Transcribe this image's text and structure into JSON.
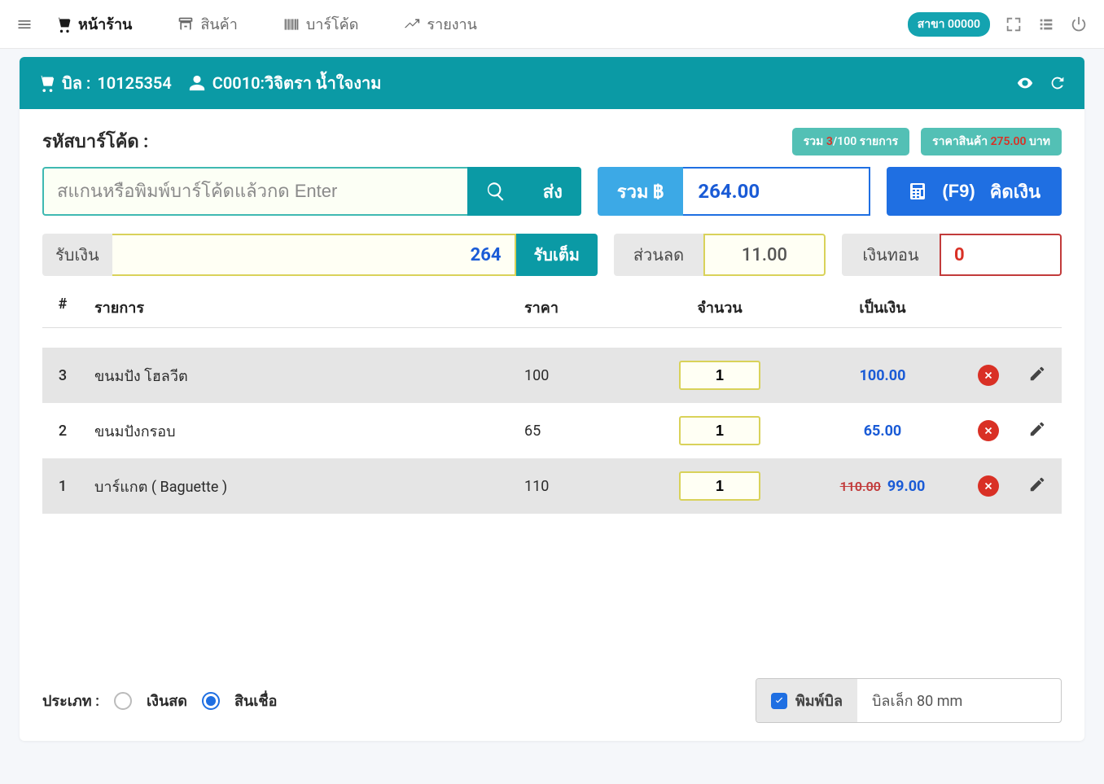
{
  "nav": {
    "items": [
      {
        "label": "หน้าร้าน",
        "active": true
      },
      {
        "label": "สินค้า",
        "active": false
      },
      {
        "label": "บาร์โค้ด",
        "active": false
      },
      {
        "label": "รายงาน",
        "active": false
      }
    ],
    "branch_badge": "สาขา 00000"
  },
  "bill": {
    "bill_prefix": "บิล :",
    "bill_no": "10125354",
    "customer": "C0010:วิจิตรา น้ำใจงาม"
  },
  "barcode": {
    "label": "รหัสบาร์โค้ด :",
    "placeholder": "สแกนหรือพิมพ์บาร์โค้ดแล้วกด Enter",
    "send_label": "ส่ง"
  },
  "summary": {
    "items_badge_prefix": "รวม ",
    "items_badge_count": "3",
    "items_badge_suffix": "/100 รายการ",
    "price_badge_prefix": "ราคาสินค้า ",
    "price_badge_amount": "275.00",
    "price_badge_suffix": " บาท",
    "total_prefix": "รวม ฿",
    "total_value": "264.00",
    "checkout_f9": "(F9)",
    "checkout_label": "คิดเงิน"
  },
  "receive": {
    "label": "รับเงิน",
    "value": "264",
    "full_label": "รับเต็ม"
  },
  "discount": {
    "label": "ส่วนลด",
    "value": "11.00"
  },
  "change": {
    "label": "เงินทอน",
    "value": "0"
  },
  "table": {
    "head_num": "#",
    "head_item": "รายการ",
    "head_price": "ราคา",
    "head_qty": "จำนวน",
    "head_amount": "เป็นเงิน",
    "rows": [
      {
        "num": "3",
        "name": "ขนมปัง โฮลวีต",
        "price": "100",
        "qty": "1",
        "amount": "100.00",
        "strike": ""
      },
      {
        "num": "2",
        "name": "ขนมปังกรอบ",
        "price": "65",
        "qty": "1",
        "amount": "65.00",
        "strike": ""
      },
      {
        "num": "1",
        "name": "บาร์แกต ( Baguette )",
        "price": "110",
        "qty": "1",
        "amount": "99.00",
        "strike": "110.00"
      }
    ]
  },
  "footer": {
    "type_label": "ประเภท :",
    "option_cash": "เงินสด",
    "option_credit": "สินเชื่อ",
    "print_label": "พิมพ์บิล",
    "print_select": "บิลเล็ก 80 mm"
  }
}
